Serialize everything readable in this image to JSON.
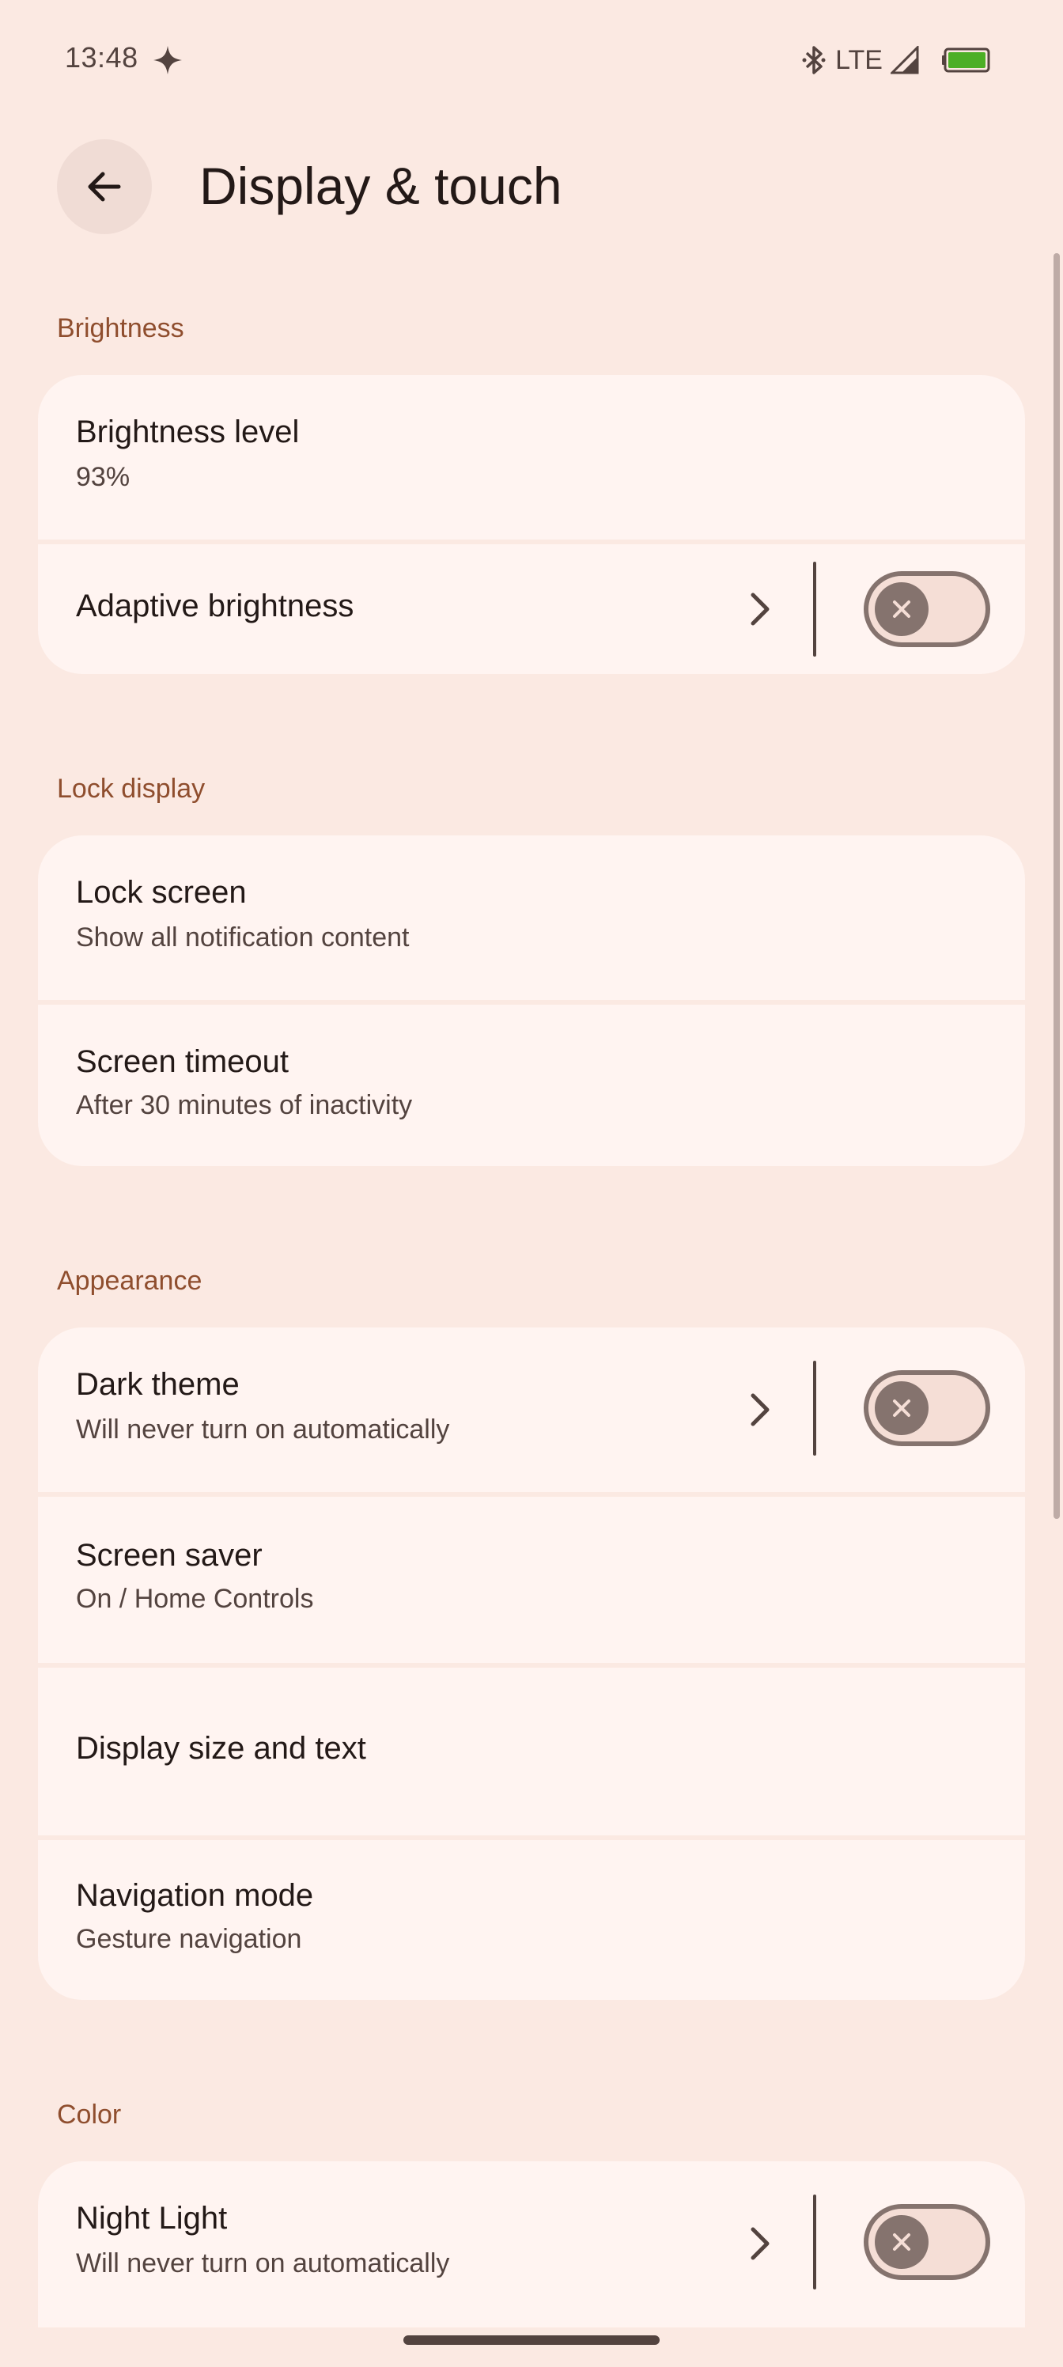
{
  "status_bar": {
    "time": "13:48",
    "network": "LTE",
    "icons": [
      "sparkle-icon",
      "bluetooth-icon",
      "signal-icon",
      "battery-icon"
    ],
    "battery_color": "#4caf26"
  },
  "header": {
    "title": "Display & touch",
    "back_icon": "arrow-back-icon"
  },
  "sections": {
    "brightness": {
      "header": "Brightness",
      "items": [
        {
          "title": "Brightness level",
          "summary": "93%"
        },
        {
          "title": "Adaptive brightness",
          "toggle": false
        }
      ]
    },
    "lock_display": {
      "header": "Lock display",
      "items": [
        {
          "title": "Lock screen",
          "summary": "Show all notification content"
        },
        {
          "title": "Screen timeout",
          "summary": "After 30 minutes of inactivity"
        }
      ]
    },
    "appearance": {
      "header": "Appearance",
      "items": [
        {
          "title": "Dark theme",
          "summary": "Will never turn on automatically",
          "toggle": false
        },
        {
          "title": "Screen saver",
          "summary": "On / Home Controls"
        },
        {
          "title": "Display size and text"
        },
        {
          "title": "Navigation mode",
          "summary": "Gesture navigation"
        }
      ]
    },
    "color": {
      "header": "Color",
      "items": [
        {
          "title": "Night Light",
          "summary": "Will never turn on automatically",
          "toggle": false
        }
      ]
    }
  },
  "colors": {
    "background": "#fbe9e2",
    "card": "#fff4f1",
    "section_header": "#8f4e2e",
    "switch_outline": "#85736e"
  }
}
